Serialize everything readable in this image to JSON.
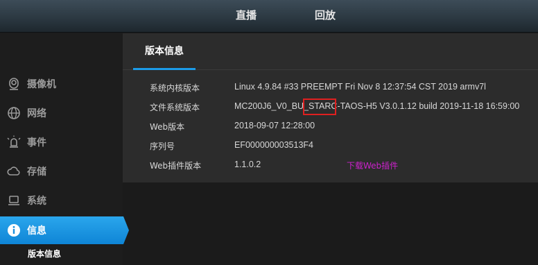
{
  "topnav": {
    "live": "直播",
    "playback": "回放"
  },
  "sidebar": {
    "items": [
      {
        "label": "摄像机",
        "icon": "camera-icon"
      },
      {
        "label": "网络",
        "icon": "globe-icon"
      },
      {
        "label": "事件",
        "icon": "alarm-icon"
      },
      {
        "label": "存储",
        "icon": "cloud-icon"
      },
      {
        "label": "系统",
        "icon": "laptop-icon"
      },
      {
        "label": "信息",
        "icon": "info-icon",
        "active": true
      }
    ],
    "sub_item": "版本信息"
  },
  "main": {
    "tab": "版本信息",
    "rows": [
      {
        "label": "系统内核版本",
        "value": "Linux 4.9.84 #33 PREEMPT Fri Nov 8 12:37:54 CST 2019 armv7l"
      },
      {
        "label": "文件系统版本",
        "value": "MC200J6_V0_BU_STARC-TAOS-H5 V3.0.1.12 build 2019-11-18 16:59:00"
      },
      {
        "label": "Web版本",
        "value": "2018-09-07 12:28:00"
      },
      {
        "label": "序列号",
        "value": "EF000000003513F4"
      },
      {
        "label": "Web插件版本",
        "value": "1.1.0.2"
      }
    ],
    "download_link": "下载Web插件"
  },
  "colors": {
    "accent": "#1c9be8",
    "highlight_border": "#e02020",
    "download_link": "#cc22cc"
  }
}
